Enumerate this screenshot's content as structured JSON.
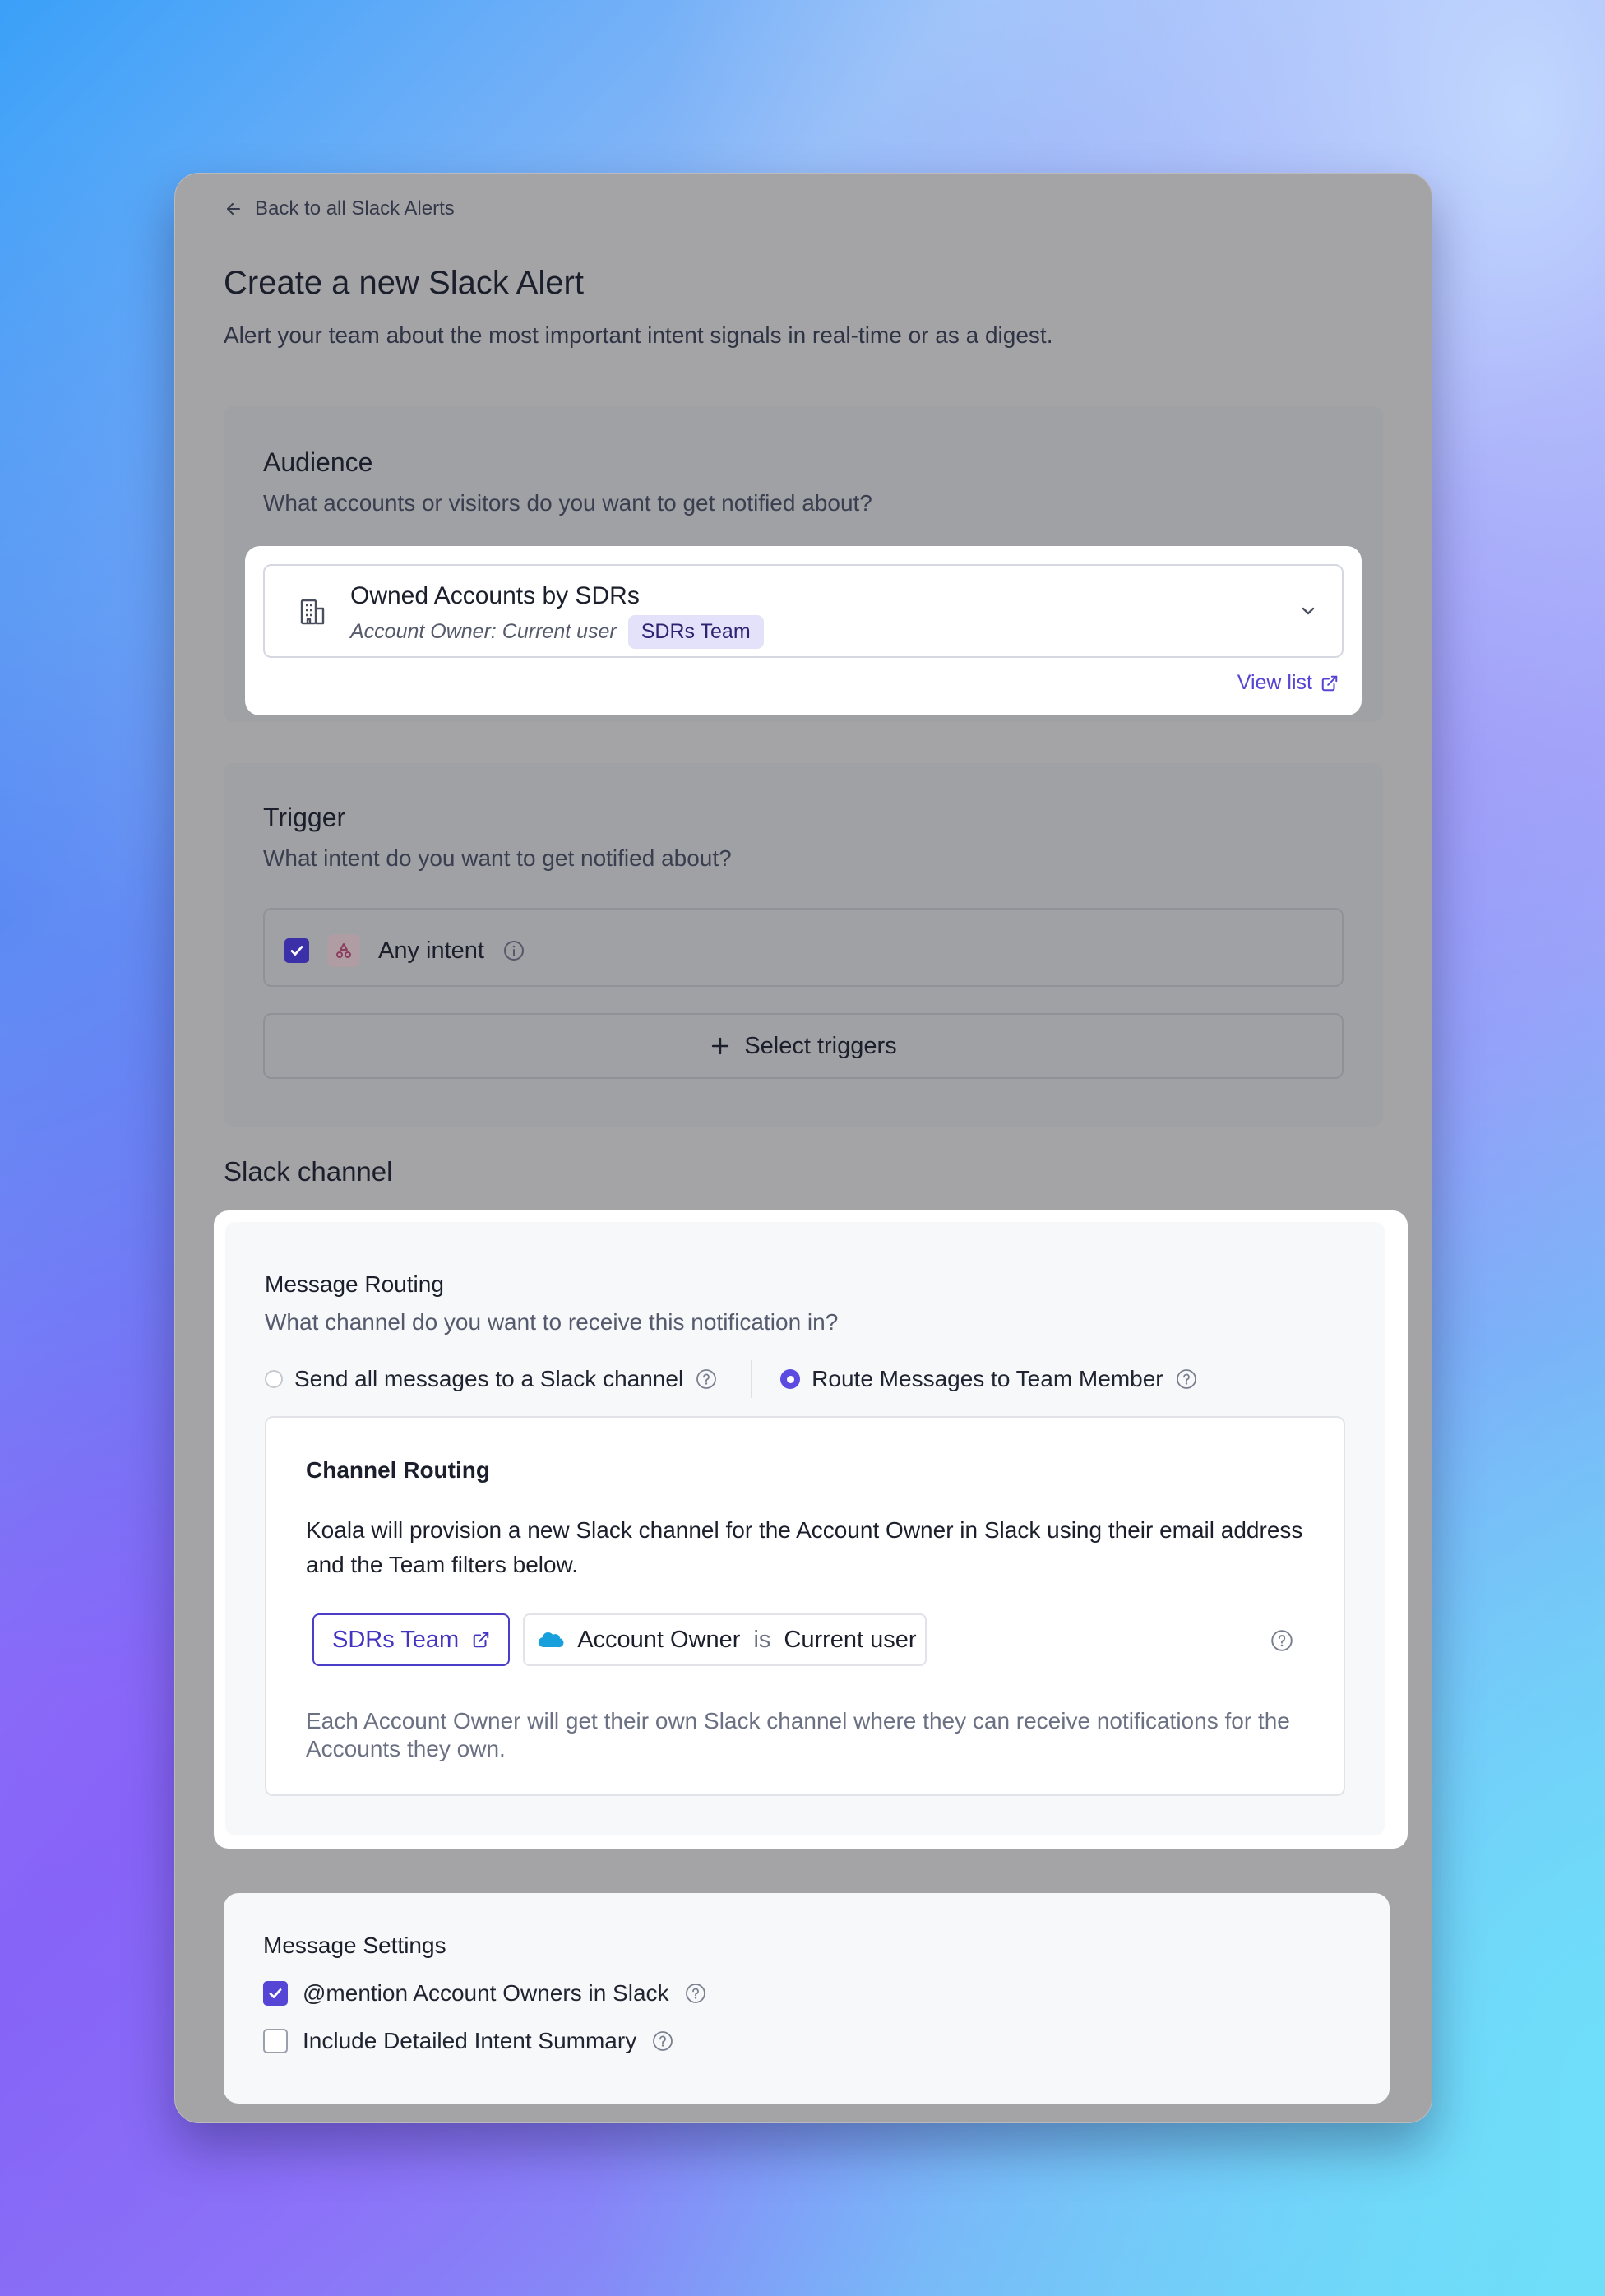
{
  "back_link": "Back to all Slack Alerts",
  "page": {
    "title": "Create a new Slack Alert",
    "subtitle": "Alert your team about the most important intent signals in real-time or as a digest."
  },
  "audience": {
    "title": "Audience",
    "description": "What accounts or visitors do you want to get notified about?",
    "selected_name": "Owned Accounts by SDRs",
    "selected_owner": "Account Owner: Current user",
    "selected_team": "SDRs Team",
    "view_list": "View list"
  },
  "trigger": {
    "title": "Trigger",
    "description": "What intent do you want to get notified about?",
    "any_intent_label": "Any intent",
    "any_intent_checked": true,
    "select_triggers": "Select triggers"
  },
  "slack_channel": {
    "section_label": "Slack channel",
    "routing_title": "Message Routing",
    "routing_desc": "What channel do you want to receive this notification in?",
    "option_channel": "Send all messages to a Slack channel",
    "option_member": "Route Messages to Team Member",
    "selected_option": "Route Messages to Team Member",
    "channel_routing": {
      "title": "Channel Routing",
      "text": "Koala will provision a new Slack channel for the Account Owner in Slack using their email address and the Team filters below.",
      "team_filter": "SDRs Team",
      "owner_field": "Account Owner",
      "owner_operator": "is",
      "owner_value": "Current user",
      "note": "Each Account Owner will get their own Slack channel where they can receive notifications for the Accounts they own."
    }
  },
  "message_settings": {
    "title": "Message Settings",
    "mention_label": "@mention Account Owners in Slack",
    "mention_checked": true,
    "summary_label": "Include Detailed Intent Summary",
    "summary_checked": false
  },
  "colors": {
    "accent": "#5b4be0",
    "overlay": "#a4a4a7",
    "tag_bg": "#e4e1fb"
  }
}
